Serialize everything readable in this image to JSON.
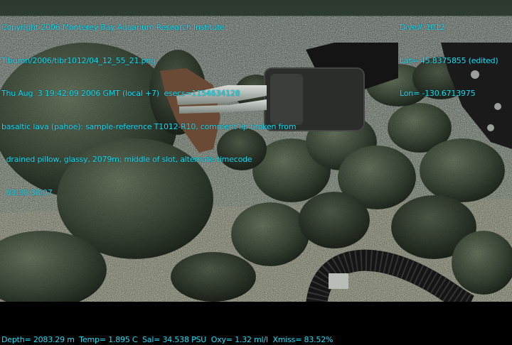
{
  "overlay": {
    "copyright": "Copyright 2006 Monterey Bay Aquarium Research Institute",
    "file_path": "Tiburon/2006/tibr1012/04_12_55_21.png",
    "timestamp_line": "Thu Aug  3 19:42:09 2006 GMT (local +7)  esecs=1154634128",
    "description_line1": "basaltic lava (pahoe): sample-reference T1012-R10, comment lip broken from",
    "description_line2": "  drained pillow, glassy, 2079m; middle of slot, alternate timecode",
    "description_line3": "  03:30:38:07",
    "dive": "Dive# 1012",
    "lat": "Lat= 45.8375855 (edited)",
    "lon": "Lon= -130.6713975",
    "telemetry": "Depth= 2083.29 m  Temp= 1.895 C  Sal= 34.538 PSU  Oxy= 1.32 ml/l  Xmiss= 83.52%"
  },
  "colors": {
    "overlay_text": "#19e0e8",
    "seafloor": "#3c4a3a",
    "sediment": "#5a5a3c"
  }
}
